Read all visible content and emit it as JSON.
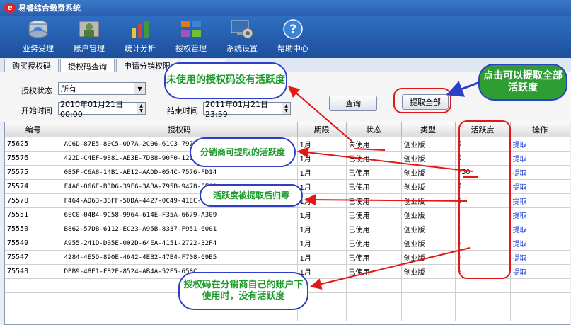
{
  "app": {
    "title": "易睿综合缴费系统",
    "logo_letter": "e"
  },
  "toolbar": [
    {
      "label": "业务受理",
      "icon": "database-icon"
    },
    {
      "label": "账户管理",
      "icon": "user-account-icon"
    },
    {
      "label": "统计分析",
      "icon": "chart-icon"
    },
    {
      "label": "授权管理",
      "icon": "authorize-icon"
    },
    {
      "label": "系统设置",
      "icon": "settings-icon"
    },
    {
      "label": "帮助中心",
      "icon": "help-icon"
    }
  ],
  "tabs": [
    {
      "label": "购买授权码",
      "active": false
    },
    {
      "label": "授权码查询",
      "active": true
    },
    {
      "label": "申请分销权限",
      "active": false
    },
    {
      "label": "授权证书",
      "active": false
    }
  ],
  "form": {
    "status_label": "授权状态",
    "status_value": "所有",
    "start_label": "开始时间",
    "start_value": "2010年01月21日 00:00",
    "end_label": "结束时间",
    "end_value": "2011年01月21日 23:59",
    "query_button": "查询",
    "extract_all_button": "提取全部"
  },
  "table": {
    "headers": [
      "编号",
      "授权码",
      "期限",
      "状态",
      "类型",
      "活跃度",
      "操作"
    ],
    "rows": [
      [
        "75625",
        "AC6D-87E5-80C5-0D7A-2C06-61C3-797D",
        "1月",
        "未使用",
        "创业版",
        "0",
        "提取"
      ],
      [
        "75576",
        "422D-C4EF-9881-AE3E-7D88-90F0-1227",
        "1月",
        "已使用",
        "创业版",
        "0",
        "提取"
      ],
      [
        "75575",
        "0B5F-C6A8-14B1-AE12-AADD-054C-7576-FD14",
        "1月",
        "已使用",
        "创业版",
        "750",
        "提取"
      ],
      [
        "75574",
        "F4A6-066E-B3D6-39F6-3ABA-795B-9478-EEA0",
        "1月",
        "已使用",
        "创业版",
        "0",
        "提取"
      ],
      [
        "75570",
        "F464-AD63-38FF-50DA-4427-0C49-41EC-1029",
        "1月",
        "已使用",
        "创业版",
        "0",
        "提取"
      ],
      [
        "75551",
        "6EC0-04B4-9C58-9964-614E-F35A-6679-A309",
        "1月",
        "已使用",
        "创业版",
        "-",
        "提取"
      ],
      [
        "75550",
        "B862-57DB-6112-EC23-A95B-8337-F951-6001",
        "1月",
        "已使用",
        "创业版",
        "-",
        "提取"
      ],
      [
        "75549",
        "A955-241D-DB5E-002D-64EA-4151-2722-32F4",
        "1月",
        "已使用",
        "创业版",
        "-",
        "提取"
      ],
      [
        "75547",
        "4284-4E5D-890E-4642-4EB2-47B4-F708-69E5",
        "1月",
        "已使用",
        "创业版",
        "-",
        "提取"
      ],
      [
        "75543",
        "DBB9-48E1-F82E-8524-AB4A-52E5-658C",
        "1月",
        "已使用",
        "创业版",
        "-",
        "提取"
      ]
    ]
  },
  "annotations": {
    "unused": "未使用的授权码没有活跃度",
    "extract_all": "点击可以提取全部活跃度",
    "distributor": "分销商可提取的活跃度",
    "reset": "活跃度被提取后归零",
    "own_account": "授权码在分销商自己的账户下使用时，没有活跃度"
  },
  "colors": {
    "toolbar": "#2f6fc1",
    "annotation_border": "#2c3fc8",
    "annotation_text": "#1d9b2a",
    "highlight": "#e01818",
    "link": "#1a3fd6"
  }
}
